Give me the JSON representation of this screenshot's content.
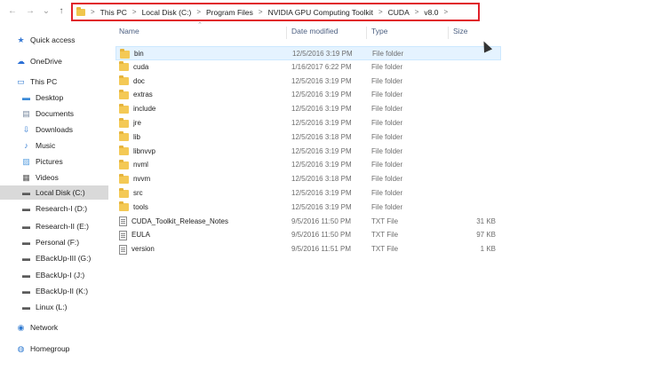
{
  "nav": {
    "back": "←",
    "forward": "→",
    "recent": "⌄",
    "up": "↑"
  },
  "breadcrumb": [
    "This PC",
    "Local Disk (C:)",
    "Program Files",
    "NVIDIA GPU Computing Toolkit",
    "CUDA",
    "v8.0"
  ],
  "breadcrumb_sep": ">",
  "columns": {
    "name": "Name",
    "date": "Date modified",
    "type": "Type",
    "size": "Size"
  },
  "sidebar": [
    {
      "label": "Quick access",
      "icon": "star-icon",
      "color": "#3a7bd5"
    },
    {
      "label": "OneDrive",
      "icon": "cloud-icon",
      "color": "#2a6fd6"
    },
    {
      "label": "This PC",
      "icon": "computer-icon",
      "color": "#2f7ad1"
    },
    {
      "label": "Desktop",
      "icon": "desktop-icon",
      "color": "#3b8ad8"
    },
    {
      "label": "Documents",
      "icon": "documents-icon",
      "color": "#7a8aa0"
    },
    {
      "label": "Downloads",
      "icon": "download-icon",
      "color": "#2f7ad1"
    },
    {
      "label": "Music",
      "icon": "music-icon",
      "color": "#2f7ad1"
    },
    {
      "label": "Pictures",
      "icon": "pictures-icon",
      "color": "#5aa0e0"
    },
    {
      "label": "Videos",
      "icon": "videos-icon",
      "color": "#5a5a5a"
    },
    {
      "label": "Local Disk (C:)",
      "icon": "drive-icon",
      "color": "#5a5a5a",
      "selected": true
    },
    {
      "label": "Research-I (D:)",
      "icon": "drive-icon",
      "color": "#5a5a5a"
    },
    {
      "label": "Research-II (E:)",
      "icon": "drive-icon",
      "color": "#5a5a5a"
    },
    {
      "label": "Personal (F:)",
      "icon": "drive-icon",
      "color": "#5a5a5a"
    },
    {
      "label": "EBackUp-III (G:)",
      "icon": "drive-icon",
      "color": "#5a5a5a"
    },
    {
      "label": "EBackUp-I (J:)",
      "icon": "drive-icon",
      "color": "#5a5a5a"
    },
    {
      "label": "EBackUp-II (K:)",
      "icon": "drive-icon",
      "color": "#5a5a5a"
    },
    {
      "label": "Linux (L:)",
      "icon": "drive-icon",
      "color": "#5a5a5a"
    },
    {
      "label": "Network",
      "icon": "network-icon",
      "color": "#2f7ad1"
    },
    {
      "label": "Homegroup",
      "icon": "homegroup-icon",
      "color": "#2f7ad1"
    }
  ],
  "files": [
    {
      "name": "bin",
      "date": "12/5/2016 3:19 PM",
      "type": "File folder",
      "size": "",
      "kind": "folder",
      "selected": true
    },
    {
      "name": "cuda",
      "date": "1/16/2017 6:22 PM",
      "type": "File folder",
      "size": "",
      "kind": "folder"
    },
    {
      "name": "doc",
      "date": "12/5/2016 3:19 PM",
      "type": "File folder",
      "size": "",
      "kind": "folder"
    },
    {
      "name": "extras",
      "date": "12/5/2016 3:19 PM",
      "type": "File folder",
      "size": "",
      "kind": "folder"
    },
    {
      "name": "include",
      "date": "12/5/2016 3:19 PM",
      "type": "File folder",
      "size": "",
      "kind": "folder"
    },
    {
      "name": "jre",
      "date": "12/5/2016 3:19 PM",
      "type": "File folder",
      "size": "",
      "kind": "folder"
    },
    {
      "name": "lib",
      "date": "12/5/2016 3:18 PM",
      "type": "File folder",
      "size": "",
      "kind": "folder"
    },
    {
      "name": "libnvvp",
      "date": "12/5/2016 3:19 PM",
      "type": "File folder",
      "size": "",
      "kind": "folder"
    },
    {
      "name": "nvml",
      "date": "12/5/2016 3:19 PM",
      "type": "File folder",
      "size": "",
      "kind": "folder"
    },
    {
      "name": "nvvm",
      "date": "12/5/2016 3:18 PM",
      "type": "File folder",
      "size": "",
      "kind": "folder"
    },
    {
      "name": "src",
      "date": "12/5/2016 3:19 PM",
      "type": "File folder",
      "size": "",
      "kind": "folder"
    },
    {
      "name": "tools",
      "date": "12/5/2016 3:19 PM",
      "type": "File folder",
      "size": "",
      "kind": "folder"
    },
    {
      "name": "CUDA_Toolkit_Release_Notes",
      "date": "9/5/2016 11:50 PM",
      "type": "TXT File",
      "size": "31 KB",
      "kind": "txt"
    },
    {
      "name": "EULA",
      "date": "9/5/2016 11:50 PM",
      "type": "TXT File",
      "size": "97 KB",
      "kind": "txt"
    },
    {
      "name": "version",
      "date": "9/5/2016 11:51 PM",
      "type": "TXT File",
      "size": "1 KB",
      "kind": "txt"
    }
  ],
  "colors": {
    "highlight_border": "#e0202a",
    "folder": "#f4c955",
    "selection": "#e5f3ff",
    "sidebar_selected": "#d9d9d9"
  }
}
